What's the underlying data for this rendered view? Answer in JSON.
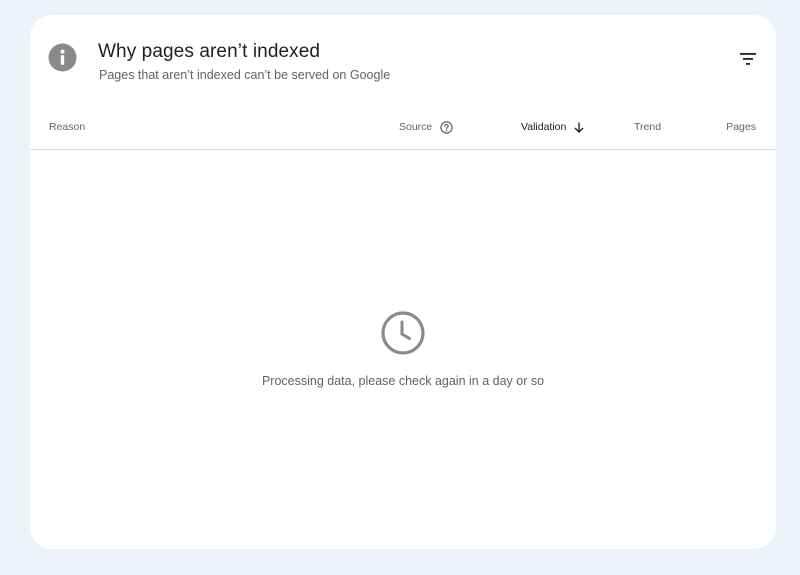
{
  "header": {
    "title": "Why pages aren’t indexed",
    "subtitle": "Pages that aren’t indexed can’t be served on Google",
    "info_icon": "info-icon",
    "filter_icon": "filter-icon"
  },
  "table": {
    "columns": [
      {
        "label": "Reason"
      },
      {
        "label": "Source",
        "icon": "help-icon"
      },
      {
        "label": "Validation",
        "icon": "arrow-down-icon",
        "sorted": "descending"
      },
      {
        "label": "Trend"
      },
      {
        "label": "Pages"
      }
    ]
  },
  "empty_state": {
    "icon": "clock-icon",
    "message": "Processing data, please check again in a day or so"
  },
  "colors": {
    "page_background": "#edf2f8",
    "card_background": "#ffffff",
    "icon_gray": "#8a8a8a",
    "text_primary": "#202124",
    "text_secondary": "#5f6368",
    "divider": "#dadce0"
  }
}
